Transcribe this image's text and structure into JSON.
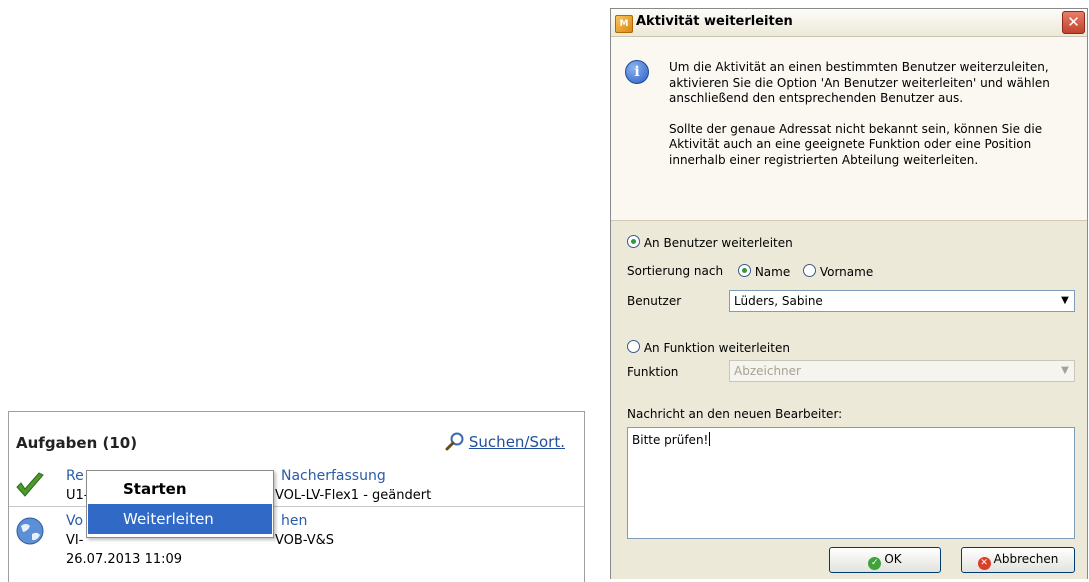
{
  "tasks": {
    "title": "Aufgaben (10)",
    "search_label": "Suchen/Sort.",
    "rows": [
      {
        "title_visible_a": "Re",
        "title_visible_b": "Nacherfassung",
        "sub_visible_a": "U1-",
        "sub_visible_b": "VOL-LV-Flex1 - geändert"
      },
      {
        "title_visible_a": "Vo",
        "title_visible_b": "hen",
        "sub_visible_a": "VI-",
        "sub_visible_b": "VOB-V&S",
        "date": "26.07.2013 11:09"
      }
    ]
  },
  "context_menu": {
    "items": [
      {
        "label": "Starten"
      },
      {
        "label": "Weiterleiten"
      }
    ]
  },
  "dialog": {
    "title": "Aktivität weiterleiten",
    "info_paragraph1": "Um die Aktivität an einen bestimmten Benutzer weiterzuleiten, aktivieren Sie die Option 'An Benutzer weiterleiten' und wählen anschließend den entsprechenden Benutzer aus.",
    "info_paragraph2": "Sollte der genaue Adressat nicht bekannt sein, können Sie die Aktivität auch an eine geeignete Funktion oder eine Position innerhalb einer registrierten Abteilung weiterleiten.",
    "option_user": "An Benutzer weiterleiten",
    "sort_label": "Sortierung nach",
    "sort_name": "Name",
    "sort_vorname": "Vorname",
    "user_label": "Benutzer",
    "user_value": "Lüders, Sabine",
    "option_function": "An Funktion weiterleiten",
    "function_label": "Funktion",
    "function_placeholder": "Abzeichner",
    "message_label": "Nachricht an den neuen Bearbeiter:",
    "message_value": "Bitte prüfen!",
    "ok_label": "OK",
    "cancel_label": "Abbrechen"
  },
  "colors": {
    "link": "#1f4f9e",
    "menu_highlight": "#3169c6",
    "dialog_bg": "#ece9d8"
  }
}
